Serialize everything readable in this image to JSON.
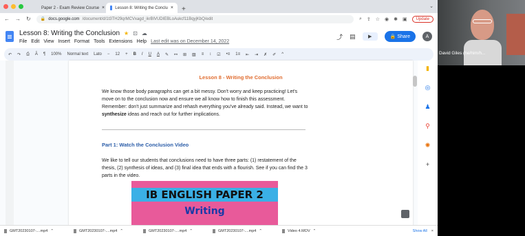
{
  "browser": {
    "tabs": [
      {
        "label": "Paper 2 - Exam Review Course",
        "active": false
      },
      {
        "label": "Lesson 8: Writing the Conclu",
        "active": true
      }
    ],
    "url_host": "docs.google.com",
    "url_path": "/document/d/1t3TH29qrMCVxagd_ikrBlVUDIEBLoAukcf11BqyjKbQ/edit",
    "update_label": "Update",
    "tab_chevron": "⌄",
    "new_tab": "+"
  },
  "doc": {
    "title": "Lesson 8: Writing the Conclusion",
    "menus": [
      "File",
      "Edit",
      "View",
      "Insert",
      "Format",
      "Tools",
      "Extensions",
      "Help"
    ],
    "last_edit": "Last edit was on December 14, 2022",
    "share_label": "Share",
    "avatar_letter": "A"
  },
  "toolbar": {
    "zoom": "100%",
    "style": "Normal text",
    "font": "Lato",
    "font_size": "12",
    "bold": "B",
    "italic": "I",
    "underline": "U",
    "textcolor": "A"
  },
  "content": {
    "heading": "Lesson 8 - Writing the Conclusion",
    "para1_a": "We know those body paragraphs can get a bit messy.  Don't worry and keep practicing! Let's move on to the conclusion now and ensure we all know how to finish this assessment. Remember: don't just summarize and rehash everything you've already said.  Instead, we want to ",
    "para1_bold": "synthesize",
    "para1_b": " ideas and reach out for further implications.",
    "part1": "Part 1: Watch the Conclusion Video",
    "para2": "We like to tell our students that conclusions need to have three parts: (1) restatement of the thesis, (2) synthesis of ideas, and (3) final idea that ends with a flourish.  See if you can find the 3 parts in the video.",
    "poster_line1": "IB ENGLISH PAPER 2",
    "poster_line2": "Writing"
  },
  "downloads": {
    "items": [
      "GMT20230107-....mp4",
      "GMT20230107-....mp4",
      "GMT20230107-....mp4",
      "GMT20230107-....mp4",
      "Video 4.MOV"
    ],
    "show_all": "Show All"
  },
  "video": {
    "participant_name": "David Giles (he/him/h..."
  },
  "colors": {
    "accent": "#1a73e8",
    "heading_orange": "#e06c2f",
    "part_blue": "#2b5da8",
    "poster_pink": "#e85a9a",
    "poster_cyan": "#3ab0e6"
  }
}
